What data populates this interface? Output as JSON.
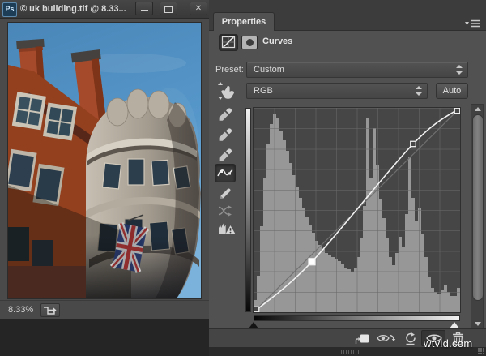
{
  "window": {
    "app_badge": "Ps",
    "title": "© uk building.tif @ 8.33...",
    "minimize_glyph": "–",
    "close_glyph": "✕"
  },
  "document": {
    "zoom_level": "8.33%"
  },
  "panel": {
    "tab_label": "Properties",
    "adjustment_title": "Curves",
    "preset_label": "Preset:",
    "preset_value": "Custom",
    "channel_value": "RGB",
    "auto_label": "Auto"
  },
  "chart_data": {
    "type": "area",
    "title": "RGB channel histogram with contrast S-curve",
    "x_range": [
      0,
      255
    ],
    "y_range": [
      0,
      255
    ],
    "grid": "10x10",
    "curve_points": [
      [
        0,
        0
      ],
      [
        72,
        63
      ],
      [
        197,
        210
      ],
      [
        255,
        255
      ]
    ],
    "selected_point_index": 1,
    "histogram_percent": [
      6,
      18,
      42,
      66,
      82,
      92,
      97,
      95,
      89,
      84,
      79,
      73,
      67,
      61,
      56,
      51,
      47,
      43,
      39,
      35,
      33,
      31,
      29,
      28,
      27,
      26,
      25,
      24,
      22,
      21,
      20,
      22,
      27,
      36,
      52,
      95,
      66,
      90,
      72,
      55,
      46,
      36,
      27,
      23,
      29,
      37,
      32,
      48,
      76,
      56,
      45,
      51,
      38,
      27,
      17,
      12,
      10,
      9,
      11,
      13,
      10,
      8,
      8,
      12
    ]
  },
  "watermark": "wtvid.com"
}
